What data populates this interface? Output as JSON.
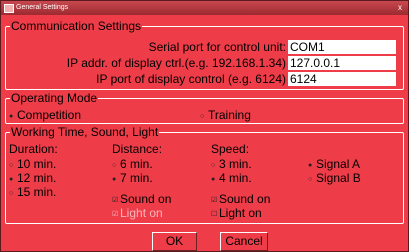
{
  "window": {
    "title": "General Settings",
    "close_glyph": "x"
  },
  "communication": {
    "legend": "Communication Settings",
    "serial_port": {
      "label": "Serial port for control unit:",
      "value": "COM1"
    },
    "ip_addr": {
      "label": "IP addr. of display ctrl.(e.g. 192.168.1.34)",
      "value": "127.0.0.1"
    },
    "ip_port": {
      "label": "IP port of display control (e.g. 6124)",
      "value": "6124"
    }
  },
  "operating_mode": {
    "legend": "Operating Mode",
    "options": [
      {
        "label": "Competition",
        "selected": true
      },
      {
        "label": "Training",
        "selected": false
      }
    ]
  },
  "working": {
    "legend": "Working Time, Sound, Light",
    "duration": {
      "header": "Duration:",
      "options": [
        {
          "label": "10 min.",
          "selected": false
        },
        {
          "label": "12 min.",
          "selected": true
        },
        {
          "label": "15 min.",
          "selected": false
        }
      ]
    },
    "distance": {
      "header": "Distance:",
      "options": [
        {
          "label": "6 min.",
          "selected": false
        },
        {
          "label": "7 min.",
          "selected": true
        }
      ]
    },
    "speed": {
      "header": "Speed:",
      "options": [
        {
          "label": "3 min.",
          "selected": false
        },
        {
          "label": "4 min.",
          "selected": true
        }
      ]
    },
    "signal": {
      "options": [
        {
          "label": "Signal A",
          "selected": true
        },
        {
          "label": "Signal B",
          "selected": false
        }
      ]
    },
    "checkboxes": {
      "distance_sound": {
        "label": "Sound on",
        "checked": true
      },
      "distance_light": {
        "label": "Light on",
        "checked": true,
        "disabled": true
      },
      "speed_sound": {
        "label": "Sound on",
        "checked": true
      },
      "speed_light": {
        "label": "Light on",
        "checked": false
      }
    }
  },
  "buttons": {
    "ok": "OK",
    "cancel": "Cancel"
  },
  "glyphs": {
    "radio_on": "●",
    "radio_off": "○",
    "check_on": "☑",
    "check_off": "☐"
  },
  "colors": {
    "background": "#ee3d49",
    "border_light": "#ffffff",
    "frame": "#7b2e34"
  }
}
